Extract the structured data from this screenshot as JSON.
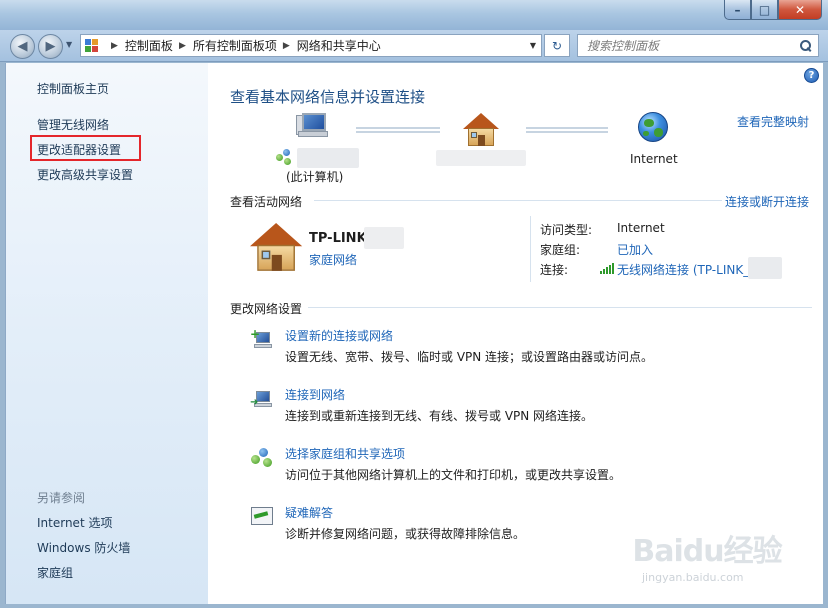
{
  "window": {
    "minimize": "–",
    "maximize": "□",
    "close": "✕"
  },
  "nav": {
    "back": "◀",
    "forward": "▶",
    "recent": "▼"
  },
  "addressbar": {
    "crumbs": [
      "控制面板",
      "所有控制面板项",
      "网络和共享中心"
    ],
    "separator": "▶",
    "dropdown": "▼",
    "refresh": "↻"
  },
  "search": {
    "placeholder": "搜索控制面板"
  },
  "sidebar": {
    "home": "控制面板主页",
    "items": [
      "管理无线网络",
      "更改适配器设置",
      "更改高级共享设置"
    ],
    "see_also_title": "另请参阅",
    "see_also": [
      "Internet 选项",
      "Windows 防火墙",
      "家庭组"
    ]
  },
  "main": {
    "help": "?",
    "title": "查看基本网络信息并设置连接",
    "full_map": "查看完整映射",
    "map": {
      "computer_label": "(此计算机)",
      "internet_label": "Internet"
    },
    "active_section": {
      "title": "查看活动网络",
      "toggle_link": "连接或断开连接",
      "network_name": "TP-LINK_",
      "network_type": "家庭网络",
      "access_type_label": "访问类型:",
      "access_type_value": "Internet",
      "homegroup_label": "家庭组:",
      "homegroup_value": "已加入",
      "connection_label": "连接:",
      "connection_value": "无线网络连接 (TP-LINK_"
    },
    "change_section": {
      "title": "更改网络设置",
      "tasks": [
        {
          "title": "设置新的连接或网络",
          "desc": "设置无线、宽带、拨号、临时或 VPN 连接；或设置路由器或访问点。"
        },
        {
          "title": "连接到网络",
          "desc": "连接到或重新连接到无线、有线、拨号或 VPN 网络连接。"
        },
        {
          "title": "选择家庭组和共享选项",
          "desc": "访问位于其他网络计算机上的文件和打印机，或更改共享设置。"
        },
        {
          "title": "疑难解答",
          "desc": "诊断并修复网络问题，或获得故障排除信息。"
        }
      ]
    }
  },
  "watermark": {
    "logo": "Baidu经验",
    "url": "jingyan.baidu.com"
  },
  "colors": {
    "link": "#1f66b8",
    "highlight": "#e4262b",
    "title": "#1e4f86"
  }
}
